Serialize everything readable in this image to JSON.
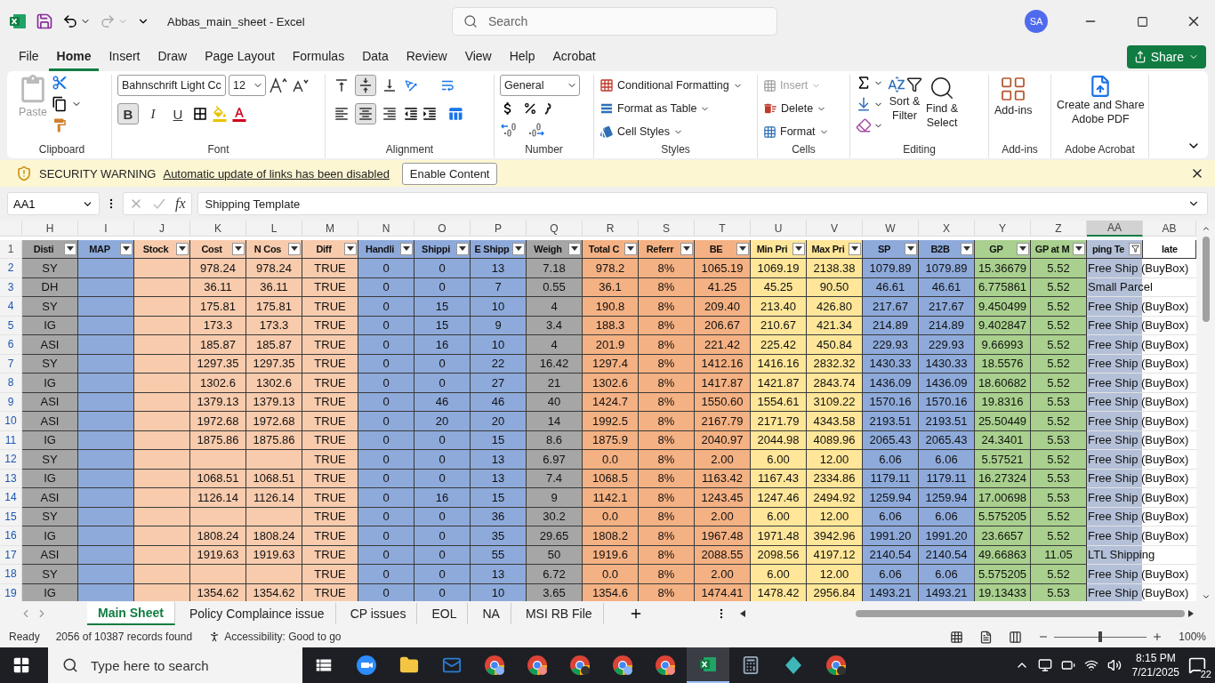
{
  "window": {
    "title": "Abbas_main_sheet  -  Excel",
    "search_placeholder": "Search",
    "avatar": "SA"
  },
  "menu": {
    "tabs": [
      {
        "label": "File",
        "selected": false
      },
      {
        "label": "Home",
        "selected": true
      },
      {
        "label": "Insert",
        "selected": false
      },
      {
        "label": "Draw",
        "selected": false
      },
      {
        "label": "Page Layout",
        "selected": false
      },
      {
        "label": "Formulas",
        "selected": false
      },
      {
        "label": "Data",
        "selected": false
      },
      {
        "label": "Review",
        "selected": false
      },
      {
        "label": "View",
        "selected": false
      },
      {
        "label": "Help",
        "selected": false
      },
      {
        "label": "Acrobat",
        "selected": false
      }
    ],
    "share": "Share"
  },
  "ribbon": {
    "clipboard": {
      "paste": "Paste",
      "label": "Clipboard"
    },
    "font": {
      "name": "Bahnschrift Light Cc",
      "size": "12",
      "label": "Font",
      "styles": [
        {
          "kind": "bold",
          "label": "B",
          "selected": true
        },
        {
          "kind": "italic",
          "label": "I",
          "selected": false
        },
        {
          "kind": "underline",
          "label": "U",
          "selected": false
        }
      ]
    },
    "alignment": {
      "label": "Alignment",
      "vertical": [
        {
          "kind": "top",
          "selected": false
        },
        {
          "kind": "middle",
          "selected": true
        },
        {
          "kind": "bottom",
          "selected": false
        }
      ],
      "horizontal": [
        {
          "kind": "left",
          "selected": false
        },
        {
          "kind": "center",
          "selected": true
        },
        {
          "kind": "right",
          "selected": false
        }
      ]
    },
    "number": {
      "format": "General",
      "label": "Number"
    },
    "styles": {
      "label": "Styles",
      "items": [
        "Conditional Formatting",
        "Format as Table",
        "Cell Styles"
      ]
    },
    "cells": {
      "label": "Cells",
      "items": [
        {
          "label": "Insert",
          "disabled": true
        },
        {
          "label": "Delete",
          "disabled": false
        },
        {
          "label": "Format",
          "disabled": false
        }
      ]
    },
    "editing": {
      "label": "Editing",
      "sort": [
        "Sort &",
        "Filter"
      ],
      "find": [
        "Find &",
        "Select"
      ]
    },
    "addins": {
      "label": "Add-ins",
      "button": "Add-ins"
    },
    "acrobat": {
      "label": "Adobe Acrobat",
      "button": [
        "Create and Share",
        "Adobe PDF"
      ]
    }
  },
  "security": {
    "title": "SECURITY WARNING",
    "message": "Automatic update of links has been disabled",
    "button": "Enable Content"
  },
  "formula_bar": {
    "name_box": "AA1",
    "fx": "fx",
    "value": "Shipping Template"
  },
  "sheet": {
    "columns": [
      {
        "letter": "H",
        "header": "Disti",
        "color": "#a6a6a6",
        "filter": true,
        "selected": false
      },
      {
        "letter": "I",
        "header": "MAP",
        "color": "#8eaadb",
        "filter": true,
        "selected": false
      },
      {
        "letter": "J",
        "header": "Stock",
        "color": "#f8cbad",
        "filter": true,
        "selected": false
      },
      {
        "letter": "K",
        "header": "Cost",
        "color": "#f8cbad",
        "filter": true,
        "selected": false
      },
      {
        "letter": "L",
        "header": "N Cos",
        "color": "#f8cbad",
        "filter": true,
        "selected": false
      },
      {
        "letter": "M",
        "header": "Diff",
        "color": "#f8cbad",
        "filter": true,
        "selected": false
      },
      {
        "letter": "N",
        "header": "Handli",
        "color": "#8eaadb",
        "filter": true,
        "selected": false
      },
      {
        "letter": "O",
        "header": "Shippi",
        "color": "#8eaadb",
        "filter": true,
        "selected": false
      },
      {
        "letter": "P",
        "header": "E Shipp",
        "color": "#8eaadb",
        "filter": true,
        "selected": false
      },
      {
        "letter": "Q",
        "header": "Weigh",
        "color": "#a6a6a6",
        "filter": true,
        "selected": false
      },
      {
        "letter": "R",
        "header": "Total C",
        "color": "#f4b183",
        "filter": true,
        "selected": false
      },
      {
        "letter": "S",
        "header": "Referr",
        "color": "#f4b183",
        "filter": true,
        "selected": false
      },
      {
        "letter": "T",
        "header": "BE",
        "color": "#f4b183",
        "filter": true,
        "selected": false
      },
      {
        "letter": "U",
        "header": "Min Pri",
        "color": "#ffe699",
        "filter": true,
        "selected": false
      },
      {
        "letter": "V",
        "header": "Max Pri",
        "color": "#ffe699",
        "filter": true,
        "selected": false
      },
      {
        "letter": "W",
        "header": "SP",
        "color": "#8eaadb",
        "filter": true,
        "selected": false
      },
      {
        "letter": "X",
        "header": "B2B",
        "color": "#8eaadb",
        "filter": true,
        "selected": false
      },
      {
        "letter": "Y",
        "header": "GP",
        "color": "#a9d08e",
        "filter": true,
        "selected": false
      },
      {
        "letter": "Z",
        "header": "GP at M",
        "color": "#a9d08e",
        "filter": true,
        "selected": false
      },
      {
        "letter": "AA",
        "header": "ping Te",
        "color": "#b4c0d8",
        "filter": true,
        "filtered": true,
        "selected": true
      },
      {
        "letter": "AB",
        "header": "late",
        "color": "#ffffff",
        "filter": false,
        "selected": false
      }
    ],
    "header_row": "1",
    "rows": [
      {
        "number": "2",
        "cells": [
          "SY",
          null,
          null,
          "978.24",
          "978.24",
          "TRUE",
          "0",
          "0",
          "13",
          "7.18",
          "978.2",
          "8%",
          "1065.19",
          "1069.19",
          "2138.38",
          "1079.89",
          "1079.89",
          "15.36679",
          "5.52",
          "Free Ship (BuyBox)"
        ]
      },
      {
        "number": "3",
        "cells": [
          "DH",
          null,
          null,
          "36.11",
          "36.11",
          "TRUE",
          "0",
          "0",
          "7",
          "0.55",
          "36.1",
          "8%",
          "41.25",
          "45.25",
          "90.50",
          "46.61",
          "46.61",
          "6.775861",
          "5.52",
          "Small Parcel"
        ]
      },
      {
        "number": "4",
        "cells": [
          "SY",
          null,
          null,
          "175.81",
          "175.81",
          "TRUE",
          "0",
          "15",
          "10",
          "4",
          "190.8",
          "8%",
          "209.40",
          "213.40",
          "426.80",
          "217.67",
          "217.67",
          "9.450499",
          "5.52",
          "Free Ship (BuyBox)"
        ]
      },
      {
        "number": "5",
        "cells": [
          "IG",
          null,
          null,
          "173.3",
          "173.3",
          "TRUE",
          "0",
          "15",
          "9",
          "3.4",
          "188.3",
          "8%",
          "206.67",
          "210.67",
          "421.34",
          "214.89",
          "214.89",
          "9.402847",
          "5.52",
          "Free Ship (BuyBox)"
        ]
      },
      {
        "number": "6",
        "cells": [
          "ASI",
          null,
          null,
          "185.87",
          "185.87",
          "TRUE",
          "0",
          "16",
          "10",
          "4",
          "201.9",
          "8%",
          "221.42",
          "225.42",
          "450.84",
          "229.93",
          "229.93",
          "9.66993",
          "5.52",
          "Free Ship (BuyBox)"
        ]
      },
      {
        "number": "7",
        "cells": [
          "SY",
          null,
          null,
          "1297.35",
          "1297.35",
          "TRUE",
          "0",
          "0",
          "22",
          "16.42",
          "1297.4",
          "8%",
          "1412.16",
          "1416.16",
          "2832.32",
          "1430.33",
          "1430.33",
          "18.5576",
          "5.52",
          "Free Ship (BuyBox)"
        ]
      },
      {
        "number": "8",
        "cells": [
          "IG",
          null,
          null,
          "1302.6",
          "1302.6",
          "TRUE",
          "0",
          "0",
          "27",
          "21",
          "1302.6",
          "8%",
          "1417.87",
          "1421.87",
          "2843.74",
          "1436.09",
          "1436.09",
          "18.60682",
          "5.52",
          "Free Ship (BuyBox)"
        ]
      },
      {
        "number": "9",
        "cells": [
          "ASI",
          null,
          null,
          "1379.13",
          "1379.13",
          "TRUE",
          "0",
          "46",
          "46",
          "40",
          "1424.7",
          "8%",
          "1550.60",
          "1554.61",
          "3109.22",
          "1570.16",
          "1570.16",
          "19.8316",
          "5.53",
          "Free Ship (BuyBox)"
        ]
      },
      {
        "number": "10",
        "cells": [
          "ASI",
          null,
          null,
          "1972.68",
          "1972.68",
          "TRUE",
          "0",
          "20",
          "20",
          "14",
          "1992.5",
          "8%",
          "2167.79",
          "2171.79",
          "4343.58",
          "2193.51",
          "2193.51",
          "25.50449",
          "5.52",
          "Free Ship (BuyBox)"
        ]
      },
      {
        "number": "11",
        "cells": [
          "IG",
          null,
          null,
          "1875.86",
          "1875.86",
          "TRUE",
          "0",
          "0",
          "15",
          "8.6",
          "1875.9",
          "8%",
          "2040.97",
          "2044.98",
          "4089.96",
          "2065.43",
          "2065.43",
          "24.3401",
          "5.53",
          "Free Ship (BuyBox)"
        ]
      },
      {
        "number": "12",
        "cells": [
          "SY",
          null,
          null,
          null,
          null,
          "TRUE",
          "0",
          "0",
          "13",
          "6.97",
          "0.0",
          "8%",
          "2.00",
          "6.00",
          "12.00",
          "6.06",
          "6.06",
          "5.57521",
          "5.52",
          "Free Ship (BuyBox)"
        ]
      },
      {
        "number": "13",
        "cells": [
          "IG",
          null,
          null,
          "1068.51",
          "1068.51",
          "TRUE",
          "0",
          "0",
          "13",
          "7.4",
          "1068.5",
          "8%",
          "1163.42",
          "1167.43",
          "2334.86",
          "1179.11",
          "1179.11",
          "16.27324",
          "5.53",
          "Free Ship (BuyBox)"
        ]
      },
      {
        "number": "14",
        "cells": [
          "ASI",
          null,
          null,
          "1126.14",
          "1126.14",
          "TRUE",
          "0",
          "16",
          "15",
          "9",
          "1142.1",
          "8%",
          "1243.45",
          "1247.46",
          "2494.92",
          "1259.94",
          "1259.94",
          "17.00698",
          "5.53",
          "Free Ship (BuyBox)"
        ]
      },
      {
        "number": "15",
        "cells": [
          "SY",
          null,
          null,
          null,
          null,
          "TRUE",
          "0",
          "0",
          "36",
          "30.2",
          "0.0",
          "8%",
          "2.00",
          "6.00",
          "12.00",
          "6.06",
          "6.06",
          "5.575205",
          "5.52",
          "Free Ship (BuyBox)"
        ]
      },
      {
        "number": "16",
        "cells": [
          "IG",
          null,
          null,
          "1808.24",
          "1808.24",
          "TRUE",
          "0",
          "0",
          "35",
          "29.65",
          "1808.2",
          "8%",
          "1967.48",
          "1971.48",
          "3942.96",
          "1991.20",
          "1991.20",
          "23.6657",
          "5.52",
          "Free Ship (BuyBox)"
        ]
      },
      {
        "number": "17",
        "cells": [
          "ASI",
          null,
          null,
          "1919.63",
          "1919.63",
          "TRUE",
          "0",
          "0",
          "55",
          "50",
          "1919.6",
          "8%",
          "2088.55",
          "2098.56",
          "4197.12",
          "2140.54",
          "2140.54",
          "49.66863",
          "11.05",
          "LTL Shipping"
        ]
      },
      {
        "number": "18",
        "cells": [
          "SY",
          null,
          null,
          null,
          null,
          "TRUE",
          "0",
          "0",
          "13",
          "6.72",
          "0.0",
          "8%",
          "2.00",
          "6.00",
          "12.00",
          "6.06",
          "6.06",
          "5.575205",
          "5.52",
          "Free Ship (BuyBox)"
        ]
      },
      {
        "number": "19",
        "cells": [
          "IG",
          null,
          null,
          "1354.62",
          "1354.62",
          "TRUE",
          "0",
          "0",
          "10",
          "3.65",
          "1354.6",
          "8%",
          "1474.41",
          "1478.42",
          "2956.84",
          "1493.21",
          "1493.21",
          "19.13433",
          "5.53",
          "Free Ship (BuyBox)"
        ]
      }
    ]
  },
  "sheet_tabs": [
    {
      "label": "Main Sheet",
      "selected": true
    },
    {
      "label": "Policy Complaince issue",
      "selected": false
    },
    {
      "label": "CP issues",
      "selected": false
    },
    {
      "label": "EOL",
      "selected": false
    },
    {
      "label": "NA",
      "selected": false
    },
    {
      "label": "MSI RB File",
      "selected": false
    }
  ],
  "status_bar": {
    "mode": "Ready",
    "records": "2056 of 10387 records found",
    "accessibility": "Accessibility: Good to go",
    "zoom": "100%",
    "zoom_slider": {
      "level": 0.5
    }
  },
  "taskbar": {
    "search_placeholder": "Type here to search",
    "time": "8:15 PM",
    "date": "7/21/2025",
    "notifications": "22"
  }
}
